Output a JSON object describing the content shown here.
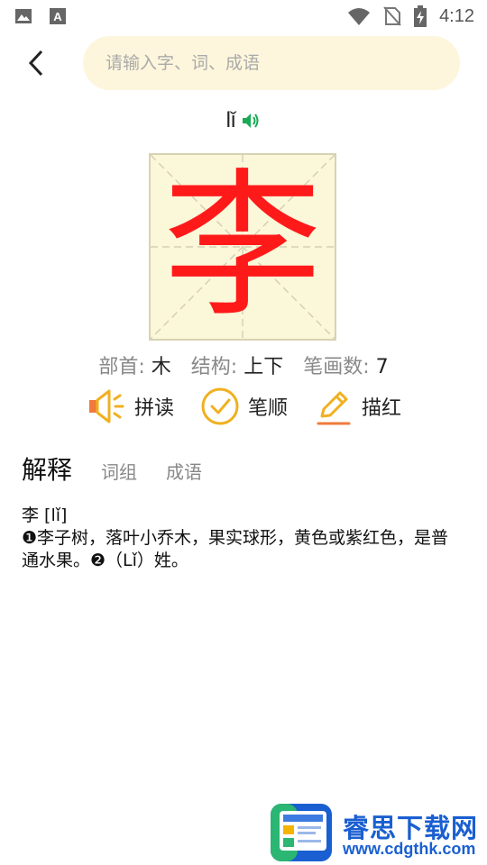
{
  "status_bar": {
    "time": "4:12"
  },
  "search": {
    "placeholder": "请输入字、词、成语"
  },
  "character": {
    "glyph": "李",
    "pinyin": "lǐ",
    "radical_label": "部首:",
    "radical": "木",
    "structure_label": "结构:",
    "structure": "上下",
    "strokes_label": "笔画数:",
    "strokes": "7"
  },
  "actions": [
    {
      "label": "拼读",
      "icon": "speaker-icon"
    },
    {
      "label": "笔顺",
      "icon": "check-circle-icon"
    },
    {
      "label": "描红",
      "icon": "pencil-icon"
    }
  ],
  "tabs": [
    {
      "label": "解释",
      "active": true
    },
    {
      "label": "词组",
      "active": false
    },
    {
      "label": "成语",
      "active": false
    }
  ],
  "definition": {
    "heading": "李 [lǐ]",
    "text": "❶李子树，落叶小乔木，果实球形，黄色或紫红色，是普通水果。❷（Lǐ）姓。"
  },
  "watermark": {
    "title": "睿思下载网",
    "url": "www.cdgthk.com"
  },
  "colors": {
    "character": "#ff1a1a",
    "search_bg": "#fdf6dc",
    "speaker_accent": "#1aaa55",
    "action_icon": "#f0b020",
    "watermark": "#1a5fd1"
  }
}
